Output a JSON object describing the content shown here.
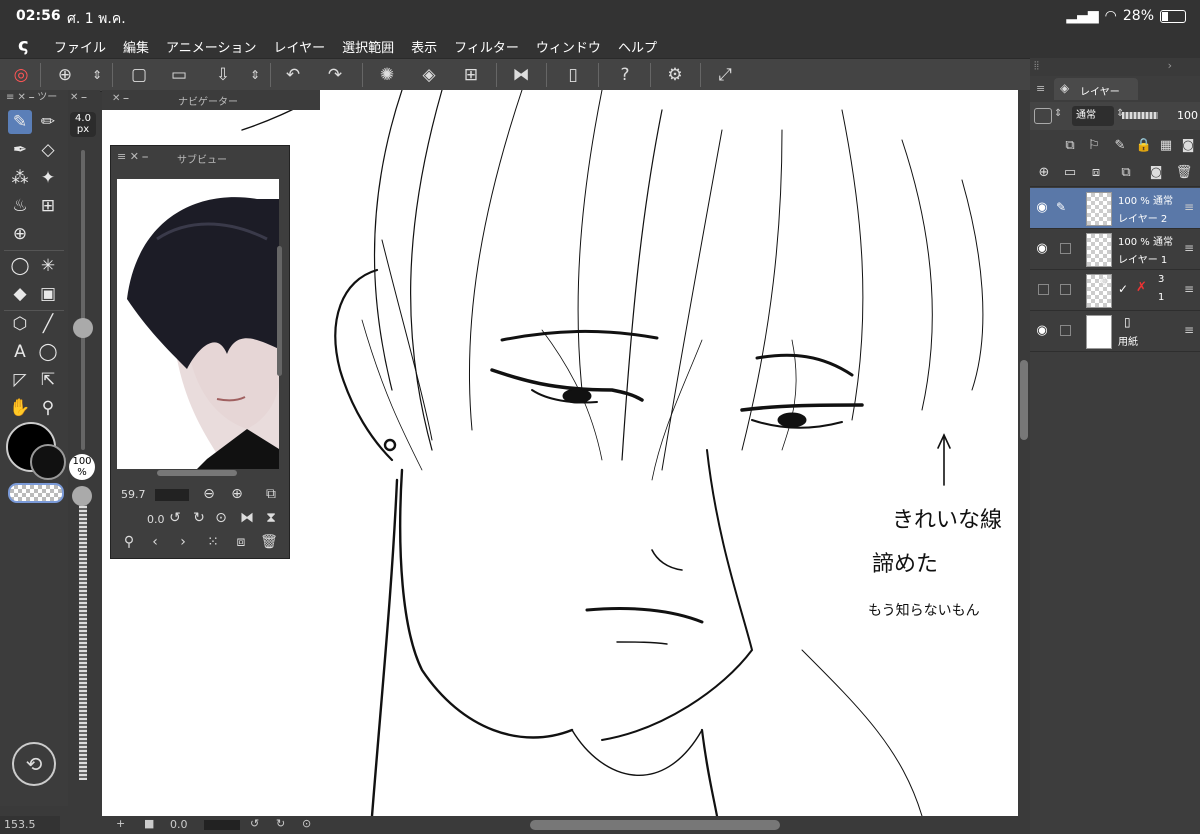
{
  "status_bar": {
    "time": "02:56",
    "date": "ศ. 1 พ.ค.",
    "battery": "28%"
  },
  "menu": {
    "logo": "ς",
    "items": [
      "ファイル",
      "編集",
      "アニメーション",
      "レイヤー",
      "選択範囲",
      "表示",
      "フィルター",
      "ウィンドウ",
      "ヘルプ"
    ]
  },
  "tool_panel": {
    "header": "ツー",
    "brush_size": "4.0",
    "brush_unit": "px",
    "opacity": "100",
    "opacity_unit": "%"
  },
  "navigator": {
    "title": "ナビゲーター"
  },
  "subview": {
    "title": "サブビュー",
    "zoom": "59.7",
    "rotation": "0.0"
  },
  "canvas": {
    "handwritten_notes": [
      "きれいな線",
      "諦めた",
      "もう知らないもん"
    ],
    "arrow": "↑"
  },
  "bottom_bar": {
    "coord": "153.5",
    "rotation": "0.0"
  },
  "layer_panel": {
    "title": "レイヤー",
    "blend_mode": "通常",
    "opacity": "100",
    "layers": [
      {
        "opacity": "100 %",
        "mode": "通常",
        "name": "レイヤー 2",
        "selected": true
      },
      {
        "opacity": "100 %",
        "mode": "通常",
        "name": "レイヤー 1",
        "selected": false
      },
      {
        "opacity": "3",
        "mode": "",
        "name": "1",
        "selected": false
      },
      {
        "opacity": "",
        "mode": "",
        "name": "用紙",
        "selected": false
      }
    ]
  },
  "colors": {
    "accent": "#5a78a8",
    "panel": "#3d3d3d",
    "canvas": "#ffffff"
  }
}
